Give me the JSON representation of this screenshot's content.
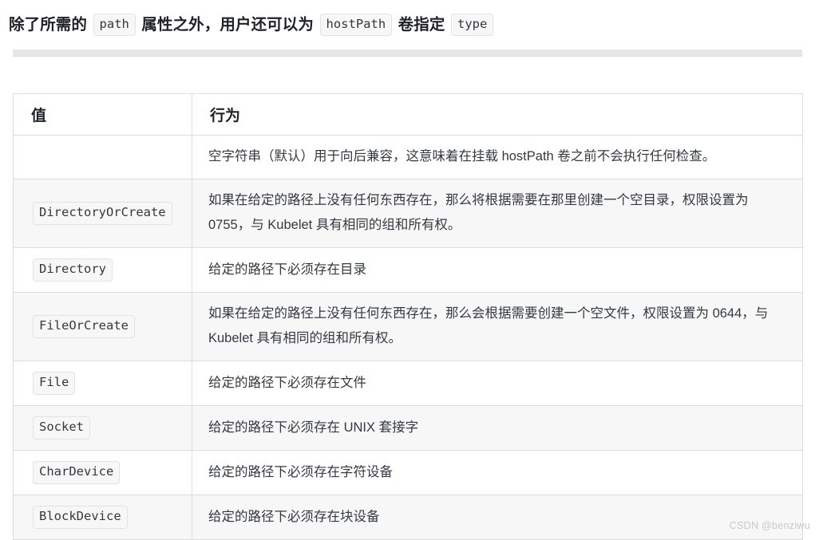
{
  "intro": {
    "seg1": "除了所需的 ",
    "code1": "path",
    "seg2": " 属性之外，用户还可以为 ",
    "code2": "hostPath",
    "seg3": " 卷指定 ",
    "code3": "type"
  },
  "table": {
    "headers": [
      "值",
      "行为"
    ],
    "rows": [
      {
        "value": "",
        "behavior": "空字符串（默认）用于向后兼容，这意味着在挂载 hostPath 卷之前不会执行任何检查。"
      },
      {
        "value": "DirectoryOrCreate",
        "behavior": "如果在给定的路径上没有任何东西存在，那么将根据需要在那里创建一个空目录，权限设置为 0755，与 Kubelet 具有相同的组和所有权。"
      },
      {
        "value": "Directory",
        "behavior": "给定的路径下必须存在目录"
      },
      {
        "value": "FileOrCreate",
        "behavior": "如果在给定的路径上没有任何东西存在，那么会根据需要创建一个空文件，权限设置为 0644，与 Kubelet 具有相同的组和所有权。"
      },
      {
        "value": "File",
        "behavior": "给定的路径下必须存在文件"
      },
      {
        "value": "Socket",
        "behavior": "给定的路径下必须存在 UNIX 套接字"
      },
      {
        "value": "CharDevice",
        "behavior": "给定的路径下必须存在字符设备"
      },
      {
        "value": "BlockDevice",
        "behavior": "给定的路径下必须存在块设备"
      }
    ]
  },
  "watermark": "CSDN @benziwu",
  "colors": {
    "code_bg": "#f7f7f8",
    "code_border": "#e3e3e6",
    "table_border": "#dcdcdc",
    "stripe_bg": "#f7f7f8",
    "divider": "#e6e6e6",
    "text": "#333a41",
    "watermark": "#c9c9c9"
  }
}
